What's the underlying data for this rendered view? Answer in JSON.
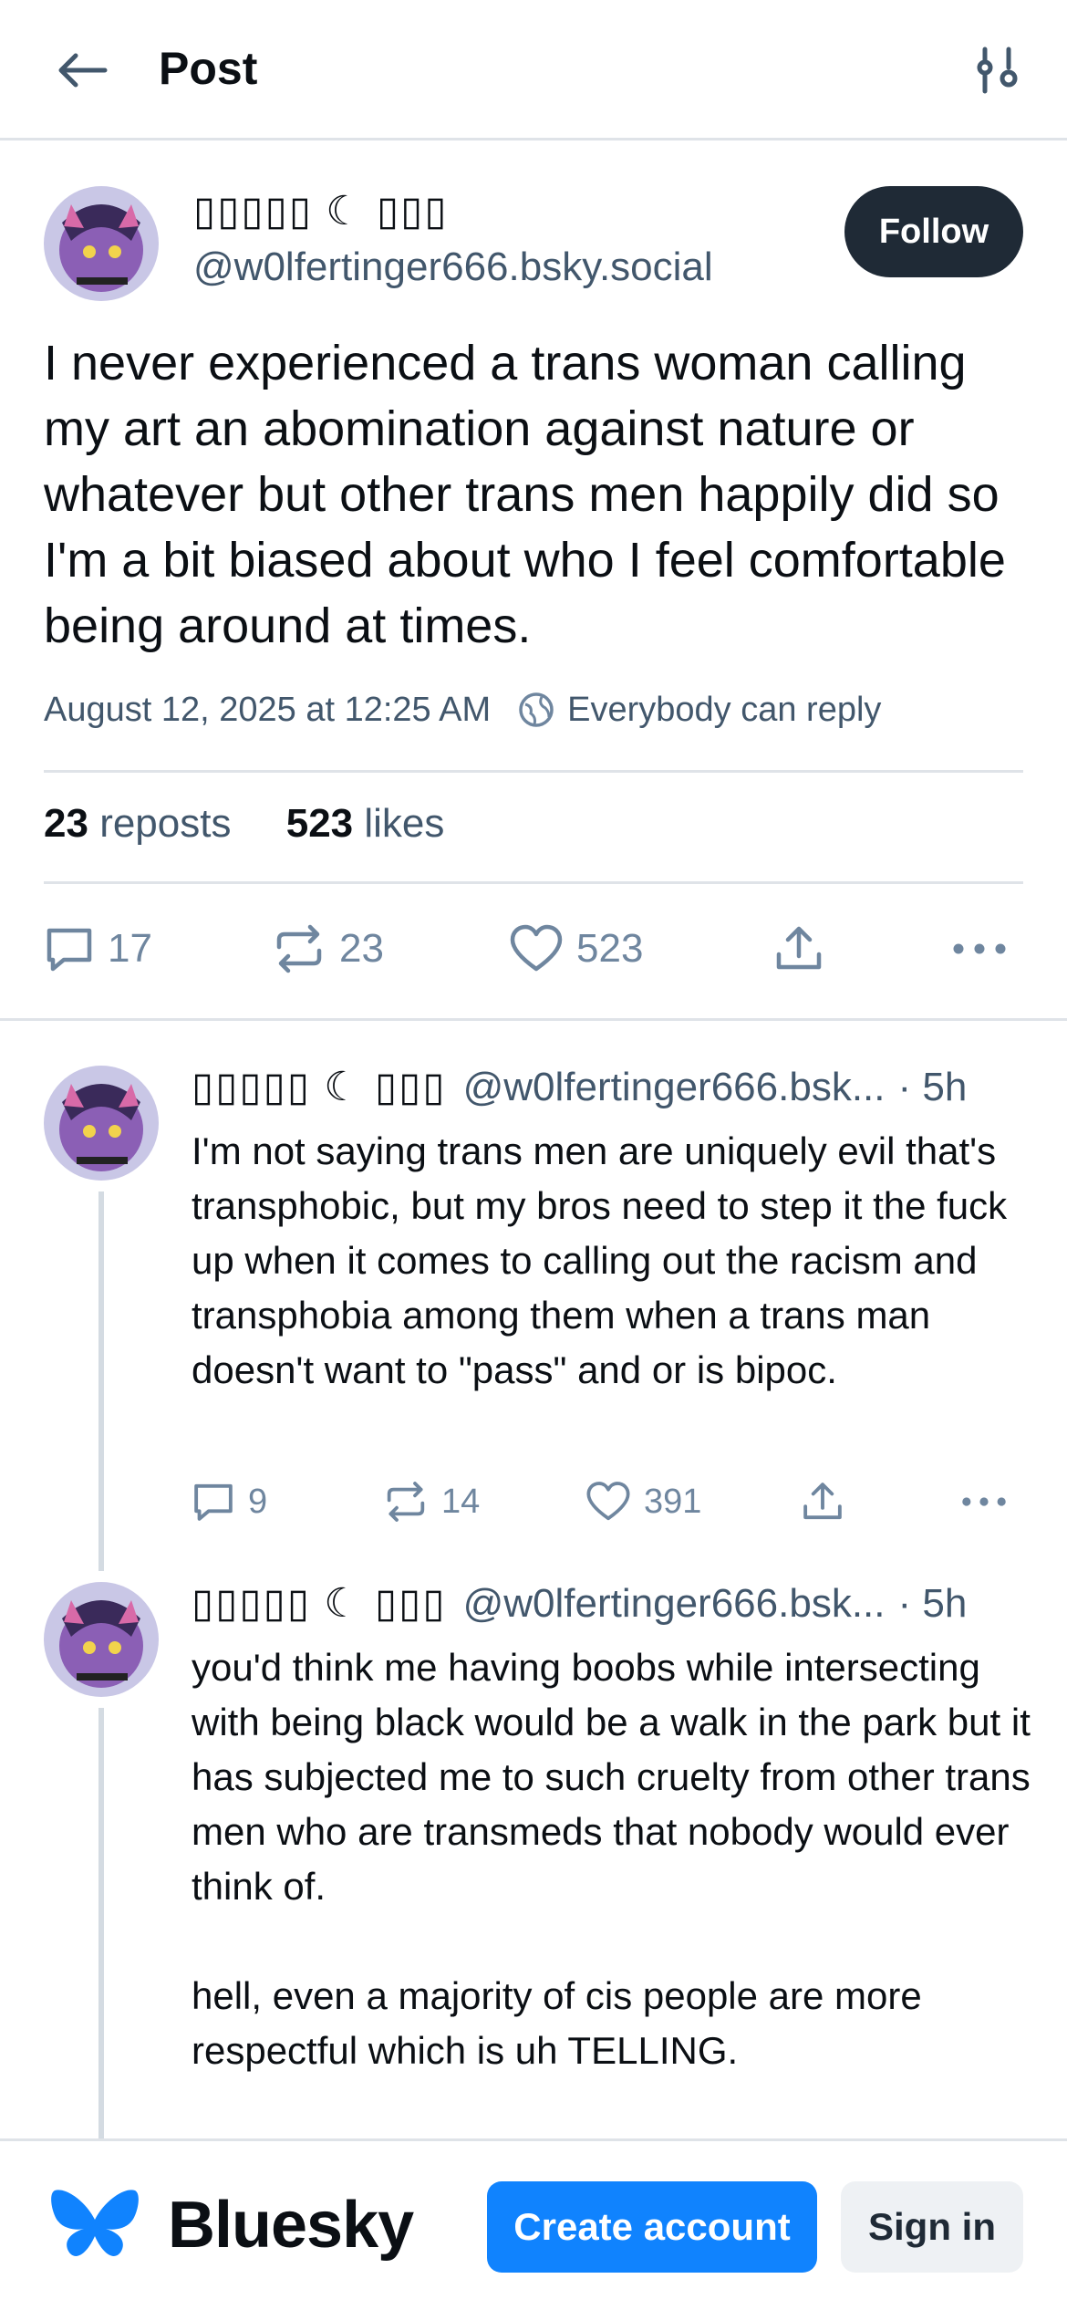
{
  "header": {
    "title": "Post",
    "back_icon": "arrow-left-icon",
    "settings_icon": "sliders-icon"
  },
  "main_post": {
    "display_name": "▯▯▯▯▯ ☾ ▯▯▯",
    "handle": "@w0lfertinger666.bsky.social",
    "follow_label": "Follow",
    "text": "I never experienced a trans woman calling my art an abomination against nature or whatever but other trans men happily did so I'm a bit biased about who I feel comfortable being around at times.",
    "timestamp": "August 12, 2025 at 12:25 AM",
    "reply_setting": "Everybody can reply",
    "stats": {
      "reposts_count": "23",
      "reposts_label": "reposts",
      "likes_count": "523",
      "likes_label": "likes"
    },
    "actions": {
      "replies": "17",
      "reposts": "23",
      "likes": "523"
    }
  },
  "replies": [
    {
      "display_name": "▯▯▯▯▯ ☾ ▯▯▯",
      "handle": "@w0lfertinger666.bsk...",
      "age": "· 5h",
      "text": "I'm not saying trans men are uniquely evil that's transphobic, but my bros need to step it the fuck up when it comes to calling out the racism and transphobia among them when a trans man doesn't want to \"pass\" and or is bipoc.",
      "actions": {
        "replies": "9",
        "reposts": "14",
        "likes": "391"
      }
    },
    {
      "display_name": "▯▯▯▯▯ ☾ ▯▯▯",
      "handle": "@w0lfertinger666.bsk...",
      "age": "· 5h",
      "text": "you'd think me having boobs while intersecting with being black would be a walk in the park but it has subjected me to such cruelty from other trans men who are transmeds that nobody would ever think of.\n\nhell, even a majority of cis people are more respectful which is uh TELLING."
    }
  ],
  "bottom_bar": {
    "brand": "Bluesky",
    "create_account": "Create account",
    "sign_in": "Sign in"
  },
  "colors": {
    "accent": "#1083fe",
    "follow_bg": "#1f2a36",
    "muted_text": "#42576c",
    "action_icon": "#6f869f",
    "divider": "#dfe3e8"
  }
}
